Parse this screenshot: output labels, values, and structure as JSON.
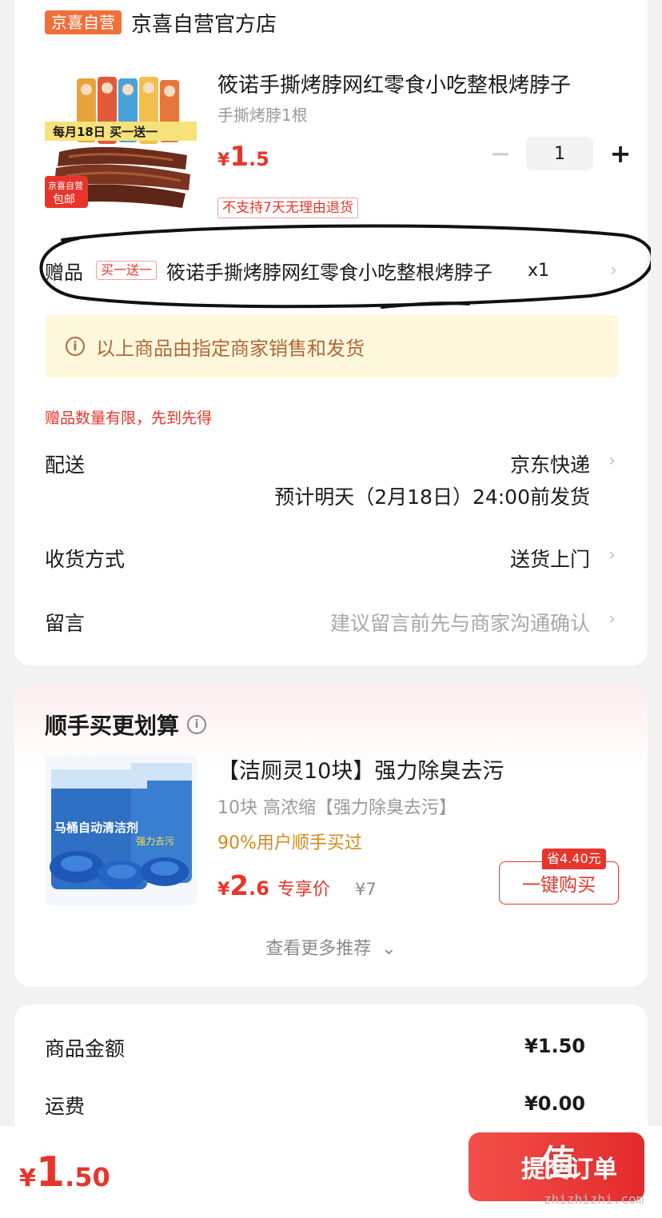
{
  "store": {
    "badge": "京喜自营",
    "name": "京喜自营官方店"
  },
  "product": {
    "title": "筱诺手撕烤脖网红零食小吃整根烤脖子",
    "spec": "手撕烤脖1根",
    "price_yen": "¥",
    "price_int": "1",
    "price_dec": ".5",
    "quantity": "1",
    "minus": "−",
    "plus": "+",
    "no_return_tag": "不支持7天无理由退货",
    "image": {
      "promo_text": "每月18日 买一送一",
      "corner_top": "京喜自营",
      "corner_bottom": "包邮"
    }
  },
  "gift": {
    "label": "赠品",
    "tag": "买一送一",
    "name": "筱诺手撕烤脖网红零食小吃整根烤脖子",
    "qty": "x1"
  },
  "notice": {
    "icon": "i",
    "text": "以上商品由指定商家销售和发货"
  },
  "limit_text": "赠品数量有限，先到先得",
  "delivery": {
    "label": "配送",
    "carrier": "京东快递",
    "estimate": "预计明天（2月18日）24:00前发货"
  },
  "receive": {
    "label": "收货方式",
    "value": "送货上门"
  },
  "message": {
    "label": "留言",
    "placeholder": "建议留言前先与商家沟通确认"
  },
  "recommend": {
    "title": "顺手买更划算",
    "info_icon": "i",
    "item": {
      "name": "【洁厕灵10块】强力除臭去污",
      "desc": "10块 高浓缩【强力除臭去污】",
      "buyers": "90%用户顺手买过",
      "price_yen": "¥",
      "price_int": "2",
      "price_dec": ".6",
      "price_note": "专享价",
      "orig_price": "¥7",
      "save_tag": "省4.40元",
      "buy_label": "一键购买",
      "image": {
        "pack_text": "马桶自动清洁剂",
        "pack_side": "强力去污"
      }
    },
    "see_more": "查看更多推荐"
  },
  "summary": {
    "goods_label": "商品金额",
    "goods_value": "¥1.50",
    "shipping_label": "运费",
    "shipping_value": "¥0.00"
  },
  "bottom": {
    "total_yen": "¥",
    "total_int": "1",
    "total_dec": ".50",
    "submit": "提交订单"
  },
  "watermark": {
    "logo": "值",
    "url": "zhizhizhi.com"
  },
  "colors": {
    "accent_red": "#e8352b",
    "badge_orange": "#f0703a",
    "notice_bg": "#fdf7dc",
    "notice_text": "#b0683a",
    "buyers_text": "#d28a1c"
  }
}
